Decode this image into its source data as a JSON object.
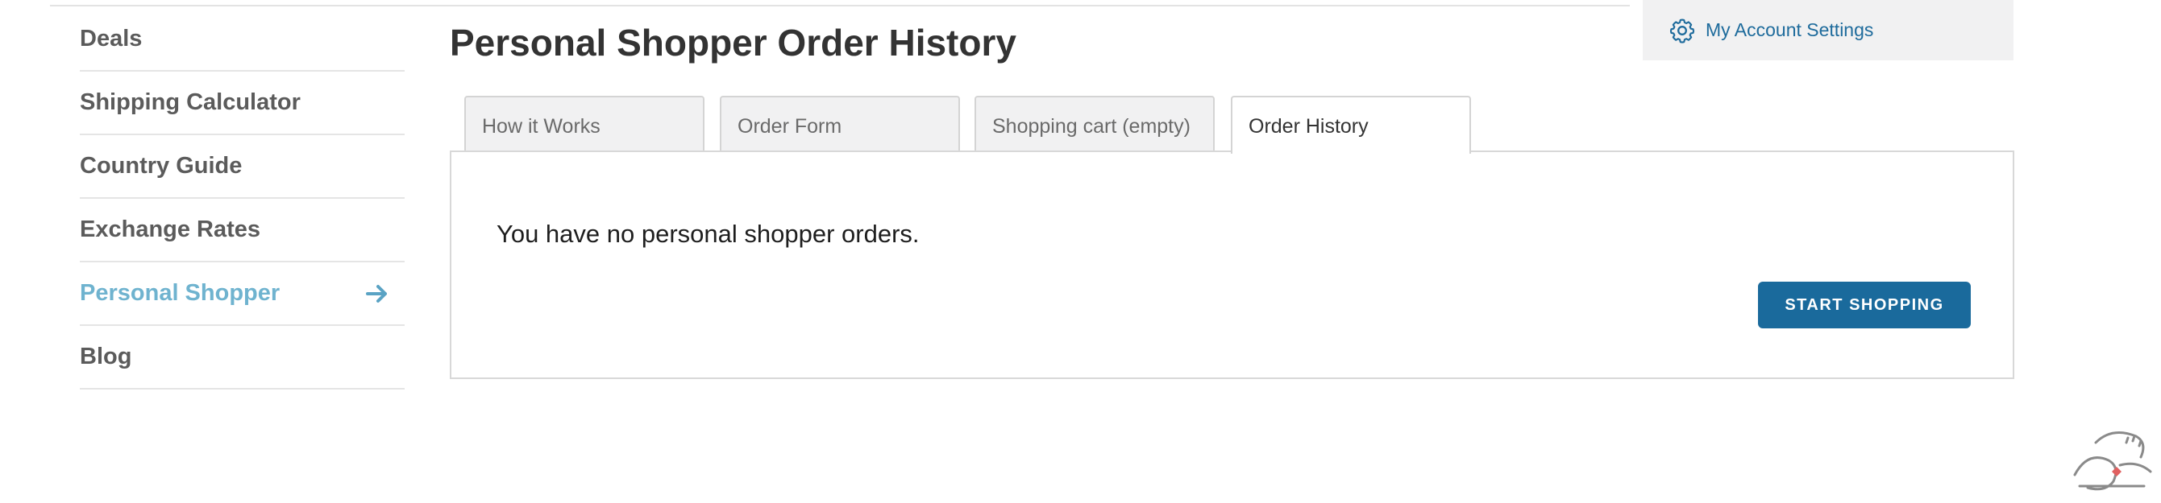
{
  "sidebar": {
    "items": [
      {
        "label": "Deals",
        "active": false
      },
      {
        "label": "Shipping Calculator",
        "active": false
      },
      {
        "label": "Country Guide",
        "active": false
      },
      {
        "label": "Exchange Rates",
        "active": false
      },
      {
        "label": "Personal Shopper",
        "active": true
      },
      {
        "label": "Blog",
        "active": false
      }
    ],
    "active_icon": "arrow-right-icon"
  },
  "main": {
    "title": "Personal Shopper Order History",
    "tabs": [
      {
        "label": "How it Works",
        "active": false
      },
      {
        "label": "Order Form",
        "active": false
      },
      {
        "label": "Shopping cart (empty)",
        "active": false
      },
      {
        "label": "Order History",
        "active": true
      }
    ],
    "empty_message": "You have no personal shopper orders.",
    "start_button": "START SHOPPING"
  },
  "account": {
    "icon": "gear-icon",
    "label": "My Account Settings"
  },
  "colors": {
    "accent": "#1a6a9c",
    "active_nav": "#6fb3cf",
    "link": "#1e6b9c"
  }
}
